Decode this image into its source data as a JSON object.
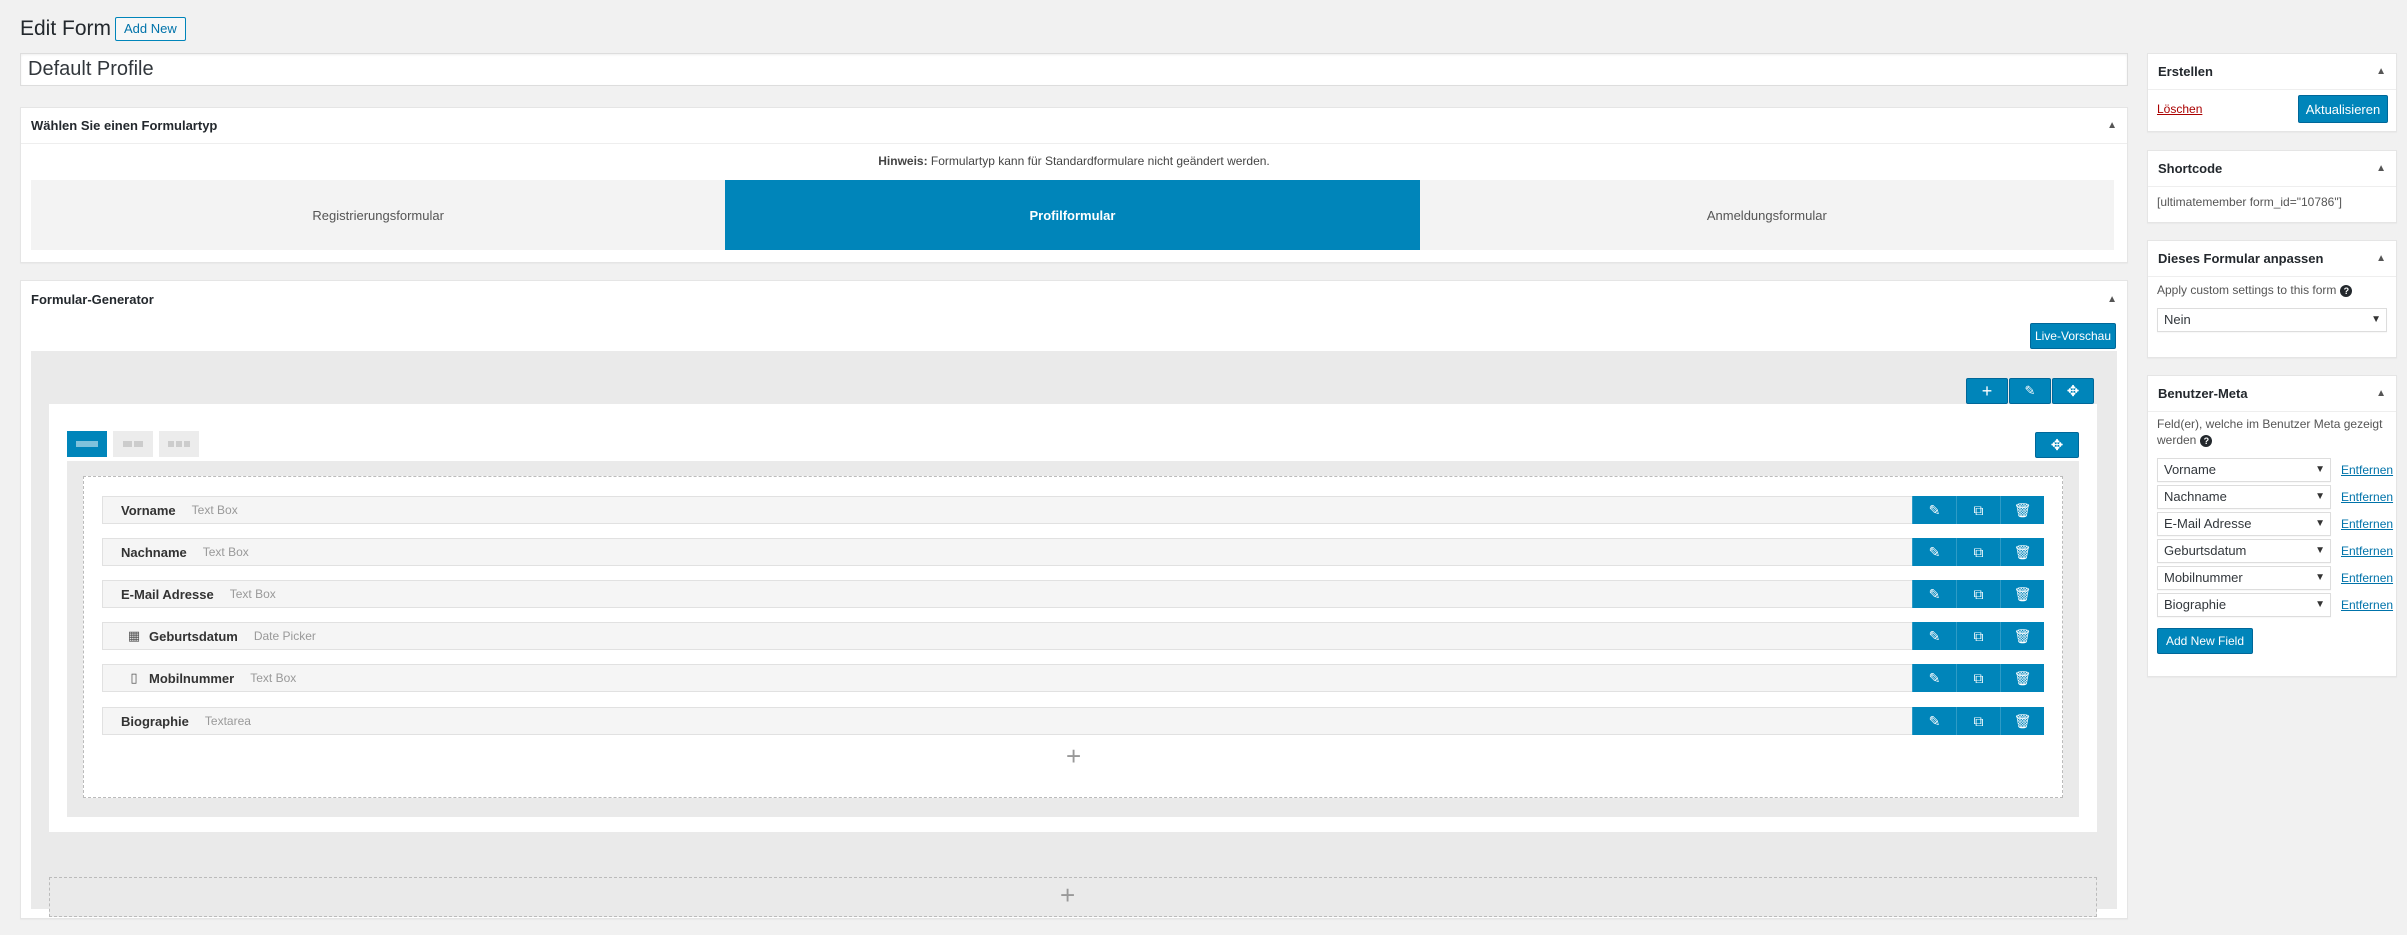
{
  "header": {
    "title": "Edit Form",
    "add_new_label": "Add New",
    "form_title_value": "Default Profile"
  },
  "form_type_box": {
    "title": "Wählen Sie einen Formulartyp",
    "notice_bold": "Hinweis:",
    "notice_text": " Formulartyp kann für Standardformulare nicht geändert werden.",
    "types": [
      {
        "label": "Registrierungsformular",
        "active": false
      },
      {
        "label": "Profilformular",
        "active": true
      },
      {
        "label": "Anmeldungsformular",
        "active": false
      }
    ]
  },
  "builder": {
    "title": "Formular-Generator",
    "live_preview_label": "Live-Vorschau",
    "fields": [
      {
        "label": "Vorname",
        "type": "Text Box",
        "icon": ""
      },
      {
        "label": "Nachname",
        "type": "Text Box",
        "icon": ""
      },
      {
        "label": "E-Mail Adresse",
        "type": "Text Box",
        "icon": ""
      },
      {
        "label": "Geburtsdatum",
        "type": "Date Picker",
        "icon": "calendar-icon"
      },
      {
        "label": "Mobilnummer",
        "type": "Text Box",
        "icon": "mobile-icon"
      },
      {
        "label": "Biographie",
        "type": "Textarea",
        "icon": ""
      }
    ]
  },
  "sidebar": {
    "publish": {
      "title": "Erstellen",
      "delete_label": "Löschen",
      "update_label": "Aktualisieren"
    },
    "shortcode": {
      "title": "Shortcode",
      "value": "[ultimatemember form_id=\"10786\"]"
    },
    "customize": {
      "title": "Dieses Formular anpassen",
      "label": "Apply custom settings to this form",
      "help": "?",
      "selected": "Nein"
    },
    "user_meta": {
      "title": "Benutzer-Meta",
      "description": "Feld(er), welche im Benutzer Meta gezeigt werden",
      "help": "?",
      "items": [
        {
          "value": "Vorname",
          "remove": "Entfernen"
        },
        {
          "value": "Nachname",
          "remove": "Entfernen"
        },
        {
          "value": "E-Mail Adresse",
          "remove": "Entfernen"
        },
        {
          "value": "Geburtsdatum",
          "remove": "Entfernen"
        },
        {
          "value": "Mobilnummer",
          "remove": "Entfernen"
        },
        {
          "value": "Biographie",
          "remove": "Entfernen"
        }
      ],
      "add_label": "Add New Field"
    }
  },
  "colors": {
    "accent": "#0085ba",
    "link": "#0073aa",
    "delete": "#a00"
  }
}
